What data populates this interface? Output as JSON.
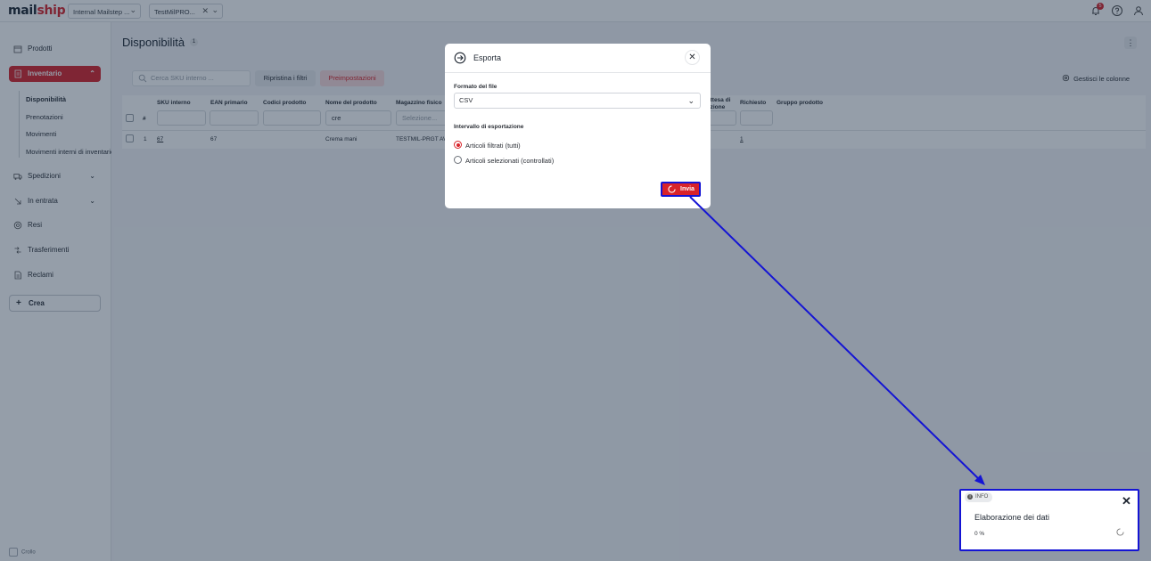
{
  "app": {
    "logo_main": "mail",
    "logo_accent": "ship",
    "org_selector": "Internal Mailstep ...",
    "warehouse_selector": "TestMilPRO...",
    "notifications_count": "5"
  },
  "sidebar": {
    "items": [
      {
        "label": "Prodotti"
      },
      {
        "label": "Inventario"
      },
      {
        "label": "Spedizioni"
      },
      {
        "label": "In entrata"
      },
      {
        "label": "Resi"
      },
      {
        "label": "Trasferimenti"
      },
      {
        "label": "Reclami"
      }
    ],
    "sub_items": [
      {
        "label": "Disponibilità"
      },
      {
        "label": "Prenotazioni"
      },
      {
        "label": "Movimenti"
      },
      {
        "label": "Movimenti interni di inventario"
      }
    ],
    "create_label": "Crea",
    "collapse_label": "Crollo"
  },
  "page": {
    "title": "Disponibilità",
    "title_count": "1",
    "more_label": "⋮"
  },
  "toolbar": {
    "search_placeholder": "Cerca SKU interno ...",
    "reset_filters": "Ripristina i filtri",
    "presets": "Preimpostazioni",
    "manage_columns": "Gestisci le colonne"
  },
  "table": {
    "headers": {
      "index": "#",
      "sku": "SKU interno",
      "ean": "EAN primario",
      "codes": "Codici prodotto",
      "name": "Nome del prodotto",
      "warehouse": "Magazzino fisico",
      "awaiting": "attesa di\nezione",
      "requested": "Richiesto",
      "group": "Gruppo prodotto"
    },
    "filters": {
      "name_value": "cre",
      "warehouse_placeholder": "Selezione..."
    },
    "rows": [
      {
        "index": "1",
        "sku": "67",
        "ean": "67",
        "name": "Crema mani",
        "warehouse": "TESTMIL-PRGT AVA",
        "requested": "1"
      }
    ]
  },
  "modal": {
    "title": "Esporta",
    "format_label": "Formato del file",
    "format_value": "CSV",
    "range_label": "Intervallo di esportazione",
    "option_filtered": "Articoli filtrati (tutti)",
    "option_selected": "Articoli selezionati (controllati)",
    "send_label": "Invia"
  },
  "toast": {
    "tag": "INFO",
    "title": "Elaborazione dei dati",
    "progress": "0 %"
  },
  "colors": {
    "brand_red": "#d8232a",
    "highlight_blue": "#1414d4",
    "overlay": "#142841"
  }
}
